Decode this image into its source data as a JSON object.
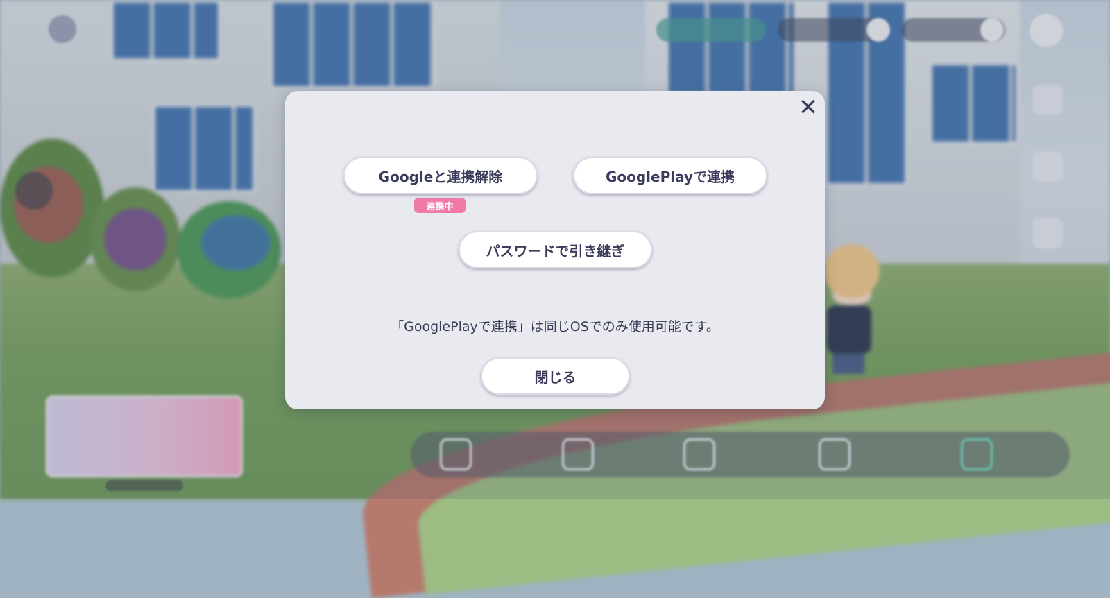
{
  "dialog": {
    "close_symbol": "✕",
    "google_unlink_label": "Googleと連携解除",
    "linked_badge": "連携中",
    "googleplay_link_label": "GooglePlayで連携",
    "password_transfer_label": "パスワードで引き継ぎ",
    "notice": "「GooglePlayで連携」は同じOSでのみ使用可能です。",
    "close_label": "閉じる"
  },
  "colors": {
    "dialog_bg": "#e9eaf0",
    "button_text": "#3b3b5c",
    "badge_pink": "#f07aa7"
  }
}
